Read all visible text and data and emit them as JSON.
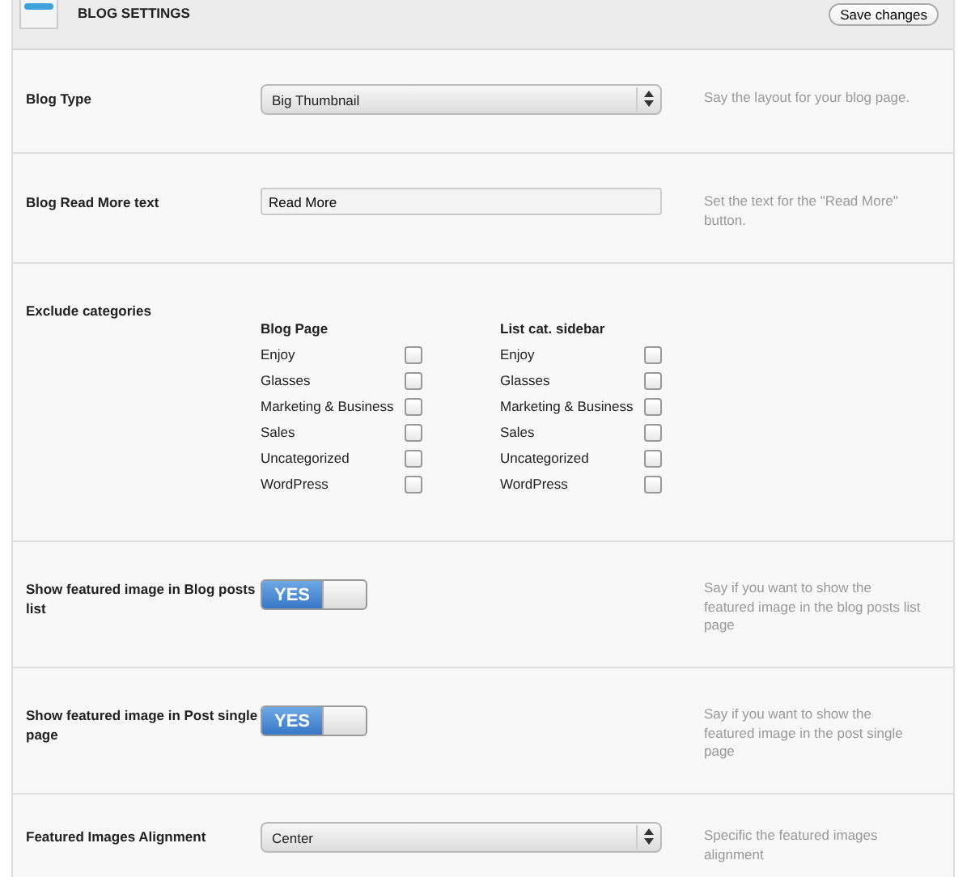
{
  "header": {
    "title": "BLOG SETTINGS",
    "save_button": "Save changes"
  },
  "rows": [
    {
      "kind": "select",
      "label": "Blog Type",
      "value": "Big Thumbnail",
      "description": "Say the layout for your blog page."
    },
    {
      "kind": "text",
      "label": "Blog Read More text",
      "value": "Read More",
      "description": "Set the text for the \"Read More\" button."
    },
    {
      "kind": "categories",
      "label": "Exclude categories",
      "groups": [
        {
          "title": "Blog Page",
          "items": [
            {
              "label": "Enjoy",
              "checked": false
            },
            {
              "label": "Glasses",
              "checked": false
            },
            {
              "label": "Marketing & Business",
              "checked": false
            },
            {
              "label": "Sales",
              "checked": false
            },
            {
              "label": "Uncategorized",
              "checked": false
            },
            {
              "label": "WordPress",
              "checked": false
            }
          ]
        },
        {
          "title": "List cat. sidebar",
          "items": [
            {
              "label": "Enjoy",
              "checked": false
            },
            {
              "label": "Glasses",
              "checked": false
            },
            {
              "label": "Marketing & Business",
              "checked": false
            },
            {
              "label": "Sales",
              "checked": false
            },
            {
              "label": "Uncategorized",
              "checked": false
            },
            {
              "label": "WordPress",
              "checked": false
            }
          ]
        }
      ]
    },
    {
      "kind": "toggle",
      "label": "Show featured image in Blog posts list",
      "on": true,
      "toggle_text": "YES",
      "description": "Say if you want to show the featured image in the blog posts list page"
    },
    {
      "kind": "toggle",
      "label": "Show featured image in Post single page",
      "on": true,
      "toggle_text": "YES",
      "description": "Say if you want to show the featured image in the post single page"
    },
    {
      "kind": "select",
      "label": "Featured Images Alignment",
      "value": "Center",
      "description": "Specific the featured images alignment"
    }
  ]
}
